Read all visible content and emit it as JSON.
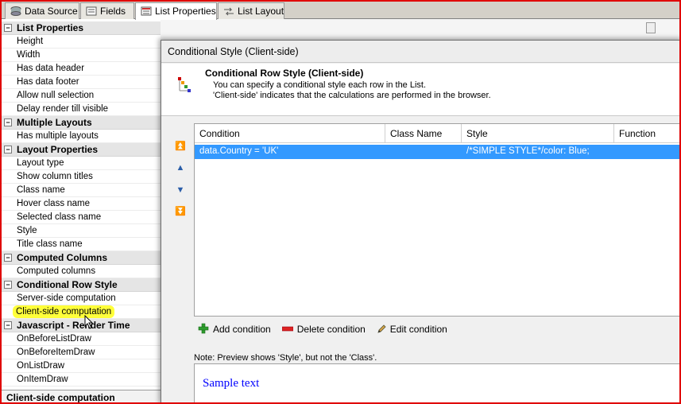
{
  "tabs": [
    {
      "label": "Data Source",
      "icon": "database-icon"
    },
    {
      "label": "Fields",
      "icon": "fields-icon"
    },
    {
      "label": "List Properties",
      "icon": "list-properties-icon"
    },
    {
      "label": "List Layout",
      "icon": "list-layout-icon"
    }
  ],
  "property_grid": {
    "categories": [
      {
        "name": "List Properties",
        "items": [
          "Height",
          "Width",
          "Has data header",
          "Has data footer",
          "Allow null selection",
          "Delay render till visible"
        ]
      },
      {
        "name": "Multiple Layouts",
        "items": [
          "Has multiple layouts"
        ]
      },
      {
        "name": "Layout Properties",
        "items": [
          "Layout type",
          "Show column titles",
          "Class name",
          "Hover class name",
          "Selected class name",
          "Style",
          "Title class name"
        ]
      },
      {
        "name": "Computed Columns",
        "items": [
          "Computed columns"
        ]
      },
      {
        "name": "Conditional Row Style",
        "items": [
          "Server-side computation",
          "Client-side computation"
        ]
      },
      {
        "name": "Javascript - Render Time",
        "items": [
          "OnBeforeListDraw",
          "OnBeforeItemDraw",
          "OnListDraw",
          "OnItemDraw"
        ]
      }
    ],
    "toggle_symbol": "−",
    "highlighted_item": "Client-side computation",
    "status": "Client-side computation"
  },
  "dialog": {
    "title": "Conditional Style (Client-side)",
    "header_title": "Conditional Row Style (Client-side)",
    "header_line1": "You can specify a conditional style each row in the List.",
    "header_line2": "'Client-side' indicates that the calculations are performed in the browser.",
    "table": {
      "columns": [
        "Condition",
        "Class Name",
        "Style",
        "Function"
      ],
      "rows": [
        {
          "condition": "data.Country = 'UK'",
          "class_name": "",
          "style": "/*SIMPLE STYLE*/color: Blue;",
          "function": ""
        }
      ]
    },
    "arrows": [
      "⏫",
      "▲",
      "▼",
      "⏬"
    ],
    "actions": {
      "add": "Add condition",
      "delete": "Delete condition",
      "edit": "Edit condition"
    },
    "note": "Note: Preview shows 'Style', but not the 'Class'.",
    "preview_text": "Sample text",
    "preview_color": "#0000ff"
  },
  "colors": {
    "frame_border": "#e00000",
    "selection": "#3399ff",
    "highlight": "#ffff3a",
    "arrow": "#2a5da8"
  }
}
